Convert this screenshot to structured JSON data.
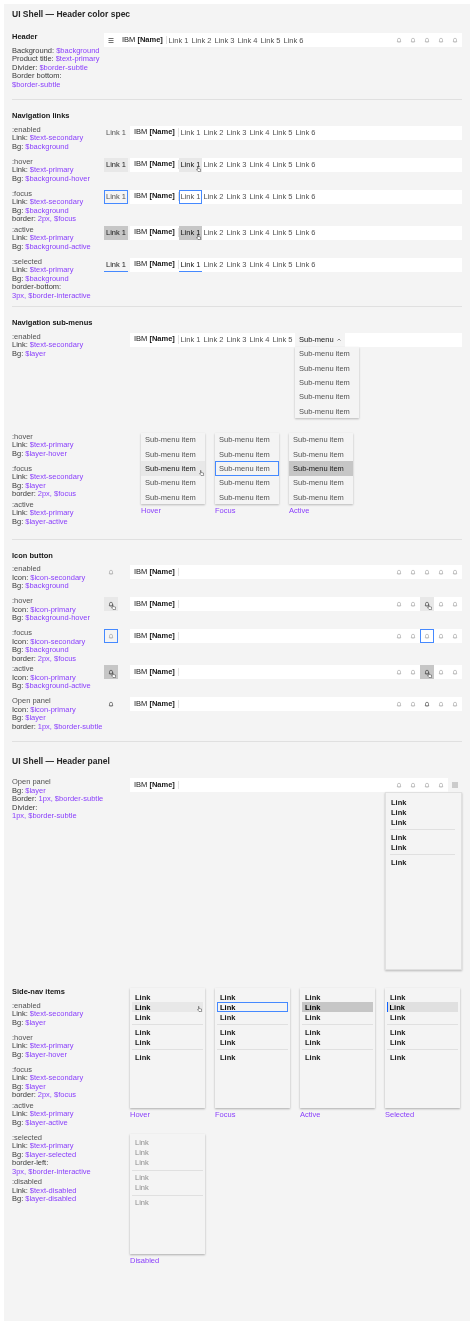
{
  "title": "UI Shell — Header color spec",
  "sections": [
    {
      "kind": "header",
      "title": "Header",
      "specs": [
        {
          "label": "Background:",
          "value": "$background"
        },
        {
          "label": "Product title:",
          "value": "$text-primary"
        },
        {
          "label": "Divider:",
          "value": "$border-subtle"
        },
        {
          "label": "Border bottom:",
          "value": "$border-subtle"
        }
      ],
      "bar": {
        "menu": true,
        "product": "IBM **[Name]**",
        "links": [
          {
            "label": "Link 1",
            "kind": "enabled"
          },
          {
            "label": "Link 2",
            "kind": "enabled"
          },
          {
            "label": "Link 3",
            "kind": "enabled"
          },
          {
            "label": "Link 4",
            "kind": "enabled"
          },
          {
            "label": "Link 5",
            "kind": "enabled"
          },
          {
            "label": "Link 6",
            "kind": "enabled"
          }
        ],
        "actions": [
          {
            "kind": "bell"
          },
          {
            "kind": "bell"
          },
          {
            "kind": "bell"
          },
          {
            "kind": "bell"
          },
          {
            "kind": "bell"
          }
        ]
      }
    },
    {
      "kind": "nav_links",
      "title": "Navigation links",
      "rows": [
        {
          "state_label": ":enabled",
          "specs": [
            {
              "label": "Link:",
              "value": "$text-secondary"
            },
            {
              "label": "Bg:",
              "value": "$background"
            }
          ],
          "sample": {
            "label": "Link 1",
            "kind": "enabled"
          },
          "bar": {
            "product": "IBM **[Name]**",
            "links": [
              {
                "label": "Link 1",
                "kind": "enabled"
              },
              {
                "label": "Link 2",
                "kind": "enabled"
              },
              {
                "label": "Link 3",
                "kind": "enabled"
              },
              {
                "label": "Link 4",
                "kind": "enabled"
              },
              {
                "label": "Link 5",
                "kind": "enabled"
              },
              {
                "label": "Link 6",
                "kind": "enabled"
              }
            ]
          }
        },
        {
          "state_label": ":hover",
          "specs": [
            {
              "label": "Link:",
              "value": "$text-primary"
            },
            {
              "label": "Bg:",
              "value": "$background-hover"
            }
          ],
          "sample": {
            "label": "Link 1",
            "kind": "hover"
          },
          "bar": {
            "product": "IBM **[Name]**",
            "links": [
              {
                "label": "Link 1",
                "kind": "hover"
              },
              {
                "label": "Link 2",
                "kind": "enabled"
              },
              {
                "label": "Link 3",
                "kind": "enabled"
              },
              {
                "label": "Link 4",
                "kind": "enabled"
              },
              {
                "label": "Link 5",
                "kind": "enabled"
              },
              {
                "label": "Link 6",
                "kind": "enabled"
              }
            ]
          }
        },
        {
          "state_label": ":focus",
          "specs": [
            {
              "label": "Link:",
              "value": "$text-secondary"
            },
            {
              "label": "Bg:",
              "value": "$background"
            },
            {
              "label": "border:",
              "value": "2px, $focus"
            }
          ],
          "sample": {
            "label": "Link 1",
            "kind": "focus"
          },
          "bar": {
            "product": "IBM **[Name]**",
            "links": [
              {
                "label": "Link 1",
                "kind": "focus"
              },
              {
                "label": "Link 2",
                "kind": "enabled"
              },
              {
                "label": "Link 3",
                "kind": "enabled"
              },
              {
                "label": "Link 4",
                "kind": "enabled"
              },
              {
                "label": "Link 5",
                "kind": "enabled"
              },
              {
                "label": "Link 6",
                "kind": "enabled"
              }
            ]
          }
        },
        {
          "state_label": ":active",
          "specs": [
            {
              "label": "Link:",
              "value": "$text-primary"
            },
            {
              "label": "Bg:",
              "value": "$background-active"
            }
          ],
          "sample": {
            "label": "Link 1",
            "kind": "active"
          },
          "bar": {
            "product": "IBM **[Name]**",
            "links": [
              {
                "label": "Link 1",
                "kind": "active"
              },
              {
                "label": "Link 2",
                "kind": "enabled"
              },
              {
                "label": "Link 3",
                "kind": "enabled"
              },
              {
                "label": "Link 4",
                "kind": "enabled"
              },
              {
                "label": "Link 5",
                "kind": "enabled"
              },
              {
                "label": "Link 6",
                "kind": "enabled"
              }
            ]
          }
        },
        {
          "state_label": ":selected",
          "specs": [
            {
              "label": "Link:",
              "value": "$text-primary"
            },
            {
              "label": "Bg:",
              "value": "$background"
            },
            {
              "label": "border-bottom:",
              "value": "3px, $border-interactive"
            }
          ],
          "sample": {
            "label": "Link 1",
            "kind": "selected"
          },
          "bar": {
            "product": "IBM **[Name]**",
            "links": [
              {
                "label": "Link 1",
                "kind": "selected"
              },
              {
                "label": "Link 2",
                "kind": "enabled"
              },
              {
                "label": "Link 3",
                "kind": "enabled"
              },
              {
                "label": "Link 4",
                "kind": "enabled"
              },
              {
                "label": "Link 5",
                "kind": "enabled"
              },
              {
                "label": "Link 6",
                "kind": "enabled"
              }
            ]
          }
        }
      ]
    },
    {
      "kind": "submenus",
      "title": "Navigation sub-menus",
      "rows": [
        {
          "state_label": ":enabled",
          "specs": [
            {
              "label": "Link:",
              "value": "$text-secondary"
            },
            {
              "label": "Bg:",
              "value": "$layer"
            }
          ],
          "bar": {
            "product": "IBM **[Name]**",
            "links": [
              {
                "label": "Link 1",
                "kind": "enabled"
              },
              {
                "label": "Link 2",
                "kind": "enabled"
              },
              {
                "label": "Link 3",
                "kind": "enabled"
              },
              {
                "label": "Link 4",
                "kind": "enabled"
              },
              {
                "label": "Link 5",
                "kind": "enabled"
              }
            ],
            "submenu": {
              "label": "Sub-menu",
              "expanded": true,
              "items": [
                "Sub-menu item",
                "Sub-menu item",
                "Sub-menu item",
                "Sub-menu item",
                "Sub-menu item"
              ]
            }
          }
        }
      ],
      "variants": [
        {
          "state_label": ":hover",
          "specs": [
            {
              "label": "Link:",
              "value": "$text-primary"
            },
            {
              "label": "Bg:",
              "value": "$layer-hover"
            }
          ],
          "menu": {
            "caption": "Hover",
            "items": [
              {
                "label": "Sub-menu item",
                "kind": "enabled"
              },
              {
                "label": "Sub-menu item",
                "kind": "enabled"
              },
              {
                "label": "Sub-menu item",
                "kind": "hover"
              },
              {
                "label": "Sub-menu item",
                "kind": "enabled"
              },
              {
                "label": "Sub-menu item",
                "kind": "enabled"
              }
            ]
          }
        },
        {
          "state_label": ":focus",
          "specs": [
            {
              "label": "Link:",
              "value": "$text-secondary"
            },
            {
              "label": "Bg:",
              "value": "$layer"
            },
            {
              "label": "border:",
              "value": "2px, $focus"
            }
          ],
          "menu": {
            "caption": "Focus",
            "items": [
              {
                "label": "Sub-menu item",
                "kind": "enabled"
              },
              {
                "label": "Sub-menu item",
                "kind": "enabled"
              },
              {
                "label": "Sub-menu item",
                "kind": "focus"
              },
              {
                "label": "Sub-menu item",
                "kind": "enabled"
              },
              {
                "label": "Sub-menu item",
                "kind": "enabled"
              }
            ]
          }
        },
        {
          "state_label": ":active",
          "specs": [
            {
              "label": "Link:",
              "value": "$text-primary"
            },
            {
              "label": "Bg:",
              "value": "$layer-active"
            }
          ],
          "menu": {
            "caption": "Active",
            "items": [
              {
                "label": "Sub-menu item",
                "kind": "enabled"
              },
              {
                "label": "Sub-menu item",
                "kind": "enabled"
              },
              {
                "label": "Sub-menu item",
                "kind": "active"
              },
              {
                "label": "Sub-menu item",
                "kind": "enabled"
              },
              {
                "label": "Sub-menu item",
                "kind": "enabled"
              }
            ]
          }
        }
      ]
    },
    {
      "kind": "icon_buttons",
      "title": "Icon button",
      "rows": [
        {
          "state_label": ":enabled",
          "specs": [
            {
              "label": "Icon:",
              "value": "$icon-secondary"
            },
            {
              "label": "Bg:",
              "value": "$background"
            }
          ],
          "sample": {
            "kind": "bell"
          },
          "bar": {
            "product": "IBM **[Name]**",
            "actions": [
              {
                "kind": "bell"
              },
              {
                "kind": "bell"
              },
              {
                "kind": "bell"
              },
              {
                "kind": "bell"
              },
              {
                "kind": "bell"
              }
            ]
          }
        },
        {
          "state_label": ":hover",
          "specs": [
            {
              "label": "Icon:",
              "value": "$icon-primary"
            },
            {
              "label": "Bg:",
              "value": "$background-hover"
            }
          ],
          "sample": {
            "kind": "bell-hover"
          },
          "bar": {
            "product": "IBM **[Name]**",
            "actions": [
              {
                "kind": "bell"
              },
              {
                "kind": "bell"
              },
              {
                "kind": "bell-hover"
              },
              {
                "kind": "bell"
              },
              {
                "kind": "bell"
              }
            ]
          }
        },
        {
          "state_label": ":focus",
          "specs": [
            {
              "label": "Icon:",
              "value": "$icon-secondary"
            },
            {
              "label": "Bg:",
              "value": "$background"
            },
            {
              "label": "border:",
              "value": "2px, $focus"
            }
          ],
          "sample": {
            "kind": "bell-focus"
          },
          "bar": {
            "product": "IBM **[Name]**",
            "actions": [
              {
                "kind": "bell"
              },
              {
                "kind": "bell"
              },
              {
                "kind": "bell-focus"
              },
              {
                "kind": "bell"
              },
              {
                "kind": "bell"
              }
            ]
          }
        },
        {
          "state_label": ":active",
          "specs": [
            {
              "label": "Icon:",
              "value": "$icon-primary"
            },
            {
              "label": "Bg:",
              "value": "$background-active"
            }
          ],
          "sample": {
            "kind": "bell-active"
          },
          "bar": {
            "product": "IBM **[Name]**",
            "actions": [
              {
                "kind": "bell"
              },
              {
                "kind": "bell"
              },
              {
                "kind": "bell-active"
              },
              {
                "kind": "bell"
              },
              {
                "kind": "bell"
              }
            ]
          }
        },
        {
          "state_label": "Open panel",
          "specs": [
            {
              "label": "Icon:",
              "value": "$icon-primary"
            },
            {
              "label": "Bg:",
              "value": "$layer"
            },
            {
              "label": "border:",
              "value": "1px, $border-subtle"
            }
          ],
          "sample": {
            "kind": "bell-open"
          },
          "bar": {
            "product": "IBM **[Name]**",
            "actions": [
              {
                "kind": "bell"
              },
              {
                "kind": "bell"
              },
              {
                "kind": "bell-open"
              },
              {
                "kind": "bell"
              },
              {
                "kind": "bell"
              }
            ]
          }
        }
      ]
    },
    {
      "kind": "panel",
      "heading": "UI Shell — Header panel",
      "rows": [
        {
          "state_label": "Open panel",
          "specs": [
            {
              "label": "Bg:",
              "value": "$layer"
            },
            {
              "label": "Border:",
              "value": "1px, $border-subtle"
            },
            {
              "label": "Divider:",
              "value": "1px, $border-subtle"
            }
          ],
          "bar": {
            "product": "IBM **[Name]**",
            "actions": [
              {
                "kind": "bell"
              },
              {
                "kind": "bell"
              },
              {
                "kind": "bell"
              },
              {
                "kind": "bell"
              },
              {
                "kind": "grid-open"
              }
            ]
          },
          "panel": {
            "groups": [
              [
                "Link",
                "Link",
                "Link"
              ],
              [
                "Link",
                "Link"
              ],
              [
                "Link"
              ]
            ]
          }
        }
      ]
    },
    {
      "kind": "sidenav",
      "title": "Side-nav items",
      "variants": [
        {
          "state_label": ":enabled",
          "specs": [
            {
              "label": "Link:",
              "value": "$text-secondary"
            },
            {
              "label": "Bg:",
              "value": "$layer"
            }
          ]
        },
        {
          "state_label": ":hover",
          "specs": [
            {
              "label": "Link:",
              "value": "$text-primary"
            },
            {
              "label": "Bg:",
              "value": "$layer-hover"
            }
          ]
        },
        {
          "state_label": ":focus",
          "specs": [
            {
              "label": "Link:",
              "value": "$text-secondary"
            },
            {
              "label": "Bg:",
              "value": "$layer"
            },
            {
              "label": "border:",
              "value": "2px, $focus"
            }
          ]
        },
        {
          "state_label": ":active",
          "specs": [
            {
              "label": "Link:",
              "value": "$text-primary"
            },
            {
              "label": "Bg:",
              "value": "$layer-active"
            }
          ]
        },
        {
          "state_label": ":selected",
          "specs": [
            {
              "label": "Link:",
              "value": "$text-primary"
            },
            {
              "label": "Bg:",
              "value": "$layer-selected"
            },
            {
              "label": "border-left:",
              "value": "3px, $border-interactive"
            }
          ]
        },
        {
          "state_label": ":disabled",
          "specs": [
            {
              "label": "Link:",
              "value": "$text-disabled"
            },
            {
              "label": "Bg:",
              "value": "$layer-disabled"
            }
          ]
        }
      ],
      "panels": [
        {
          "caption": "Hover",
          "groups": [
            [
              {
                "label": "Link",
                "kind": "enabled"
              },
              {
                "label": "Link",
                "kind": "hover"
              },
              {
                "label": "Link",
                "kind": "enabled"
              }
            ],
            [
              {
                "label": "Link",
                "kind": "enabled"
              },
              {
                "label": "Link",
                "kind": "enabled"
              }
            ],
            [
              {
                "label": "Link",
                "kind": "enabled"
              }
            ]
          ]
        },
        {
          "caption": "Focus",
          "groups": [
            [
              {
                "label": "Link",
                "kind": "enabled"
              },
              {
                "label": "Link",
                "kind": "focus"
              },
              {
                "label": "Link",
                "kind": "enabled"
              }
            ],
            [
              {
                "label": "Link",
                "kind": "enabled"
              },
              {
                "label": "Link",
                "kind": "enabled"
              }
            ],
            [
              {
                "label": "Link",
                "kind": "enabled"
              }
            ]
          ]
        },
        {
          "caption": "Active",
          "groups": [
            [
              {
                "label": "Link",
                "kind": "enabled"
              },
              {
                "label": "Link",
                "kind": "active"
              },
              {
                "label": "Link",
                "kind": "enabled"
              }
            ],
            [
              {
                "label": "Link",
                "kind": "enabled"
              },
              {
                "label": "Link",
                "kind": "enabled"
              }
            ],
            [
              {
                "label": "Link",
                "kind": "enabled"
              }
            ]
          ]
        },
        {
          "caption": "Selected",
          "groups": [
            [
              {
                "label": "Link",
                "kind": "enabled"
              },
              {
                "label": "Link",
                "kind": "selected"
              },
              {
                "label": "Link",
                "kind": "enabled"
              }
            ],
            [
              {
                "label": "Link",
                "kind": "enabled"
              },
              {
                "label": "Link",
                "kind": "enabled"
              }
            ],
            [
              {
                "label": "Link",
                "kind": "enabled"
              }
            ]
          ]
        },
        {
          "caption": "Disabled",
          "groups": [
            [
              {
                "label": "Link",
                "kind": "disabled"
              },
              {
                "label": "Link",
                "kind": "disabled"
              },
              {
                "label": "Link",
                "kind": "disabled"
              }
            ],
            [
              {
                "label": "Link",
                "kind": "disabled"
              },
              {
                "label": "Link",
                "kind": "disabled"
              }
            ],
            [
              {
                "label": "Link",
                "kind": "disabled"
              }
            ]
          ]
        }
      ]
    }
  ]
}
